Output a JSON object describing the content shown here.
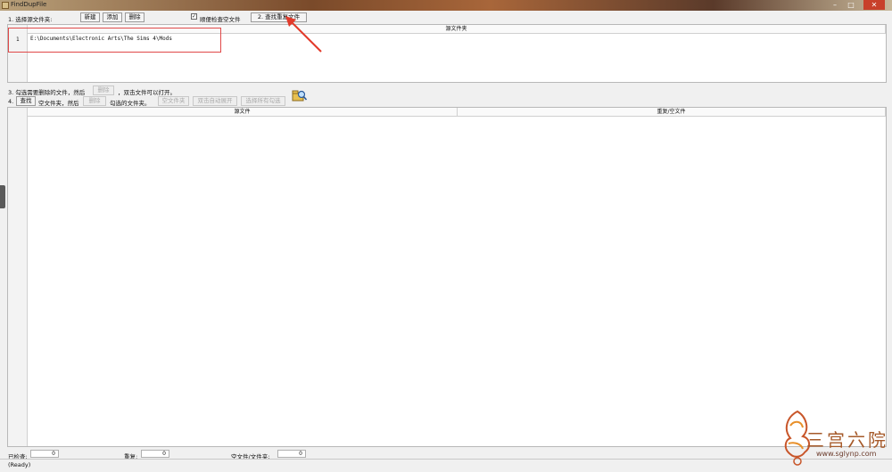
{
  "window": {
    "title": "FindDupFile",
    "accent": "#c8402a"
  },
  "step1": {
    "label": "1. 选择源文件夹:",
    "new_label": "新建",
    "add_label": "添加",
    "delete_label": "删除",
    "checkbox_checked": true,
    "checkbox_label": "顺便检查空文件",
    "find_label": "2. 查找重复文件"
  },
  "source_table": {
    "header": "源文件夹",
    "rows": [
      {
        "index": "1",
        "path": "E:\\Documents\\Electronic Arts\\The Sims 4\\Mods"
      }
    ]
  },
  "step3": {
    "prefix": "3. 勾选需要删除的文件，然后",
    "delete_label": "删除",
    "suffix": "，双击文件可以打开。"
  },
  "step4": {
    "prefix": "4.",
    "find_label": "查找",
    "middle": "空文件夹，然后",
    "delete_label": "删除",
    "suffix": "勾选的文件夹。",
    "btn_a": "空文件夹",
    "btn_b": "双击自动展开",
    "btn_c": "选择所有勾选",
    "icon": "search-folder-icon"
  },
  "results_table": {
    "col_source": "源文件",
    "col_dup": "重复/空文件"
  },
  "counters": {
    "checked_label": "已检查:",
    "checked_value": "0",
    "dup_label": "重复:",
    "dup_value": "0",
    "empty_label": "空文件/文件夹:",
    "empty_value": "0"
  },
  "status": {
    "text": "(Ready)"
  },
  "watermark": {
    "text": "三宫六院",
    "url": "www.sglynp.com"
  }
}
